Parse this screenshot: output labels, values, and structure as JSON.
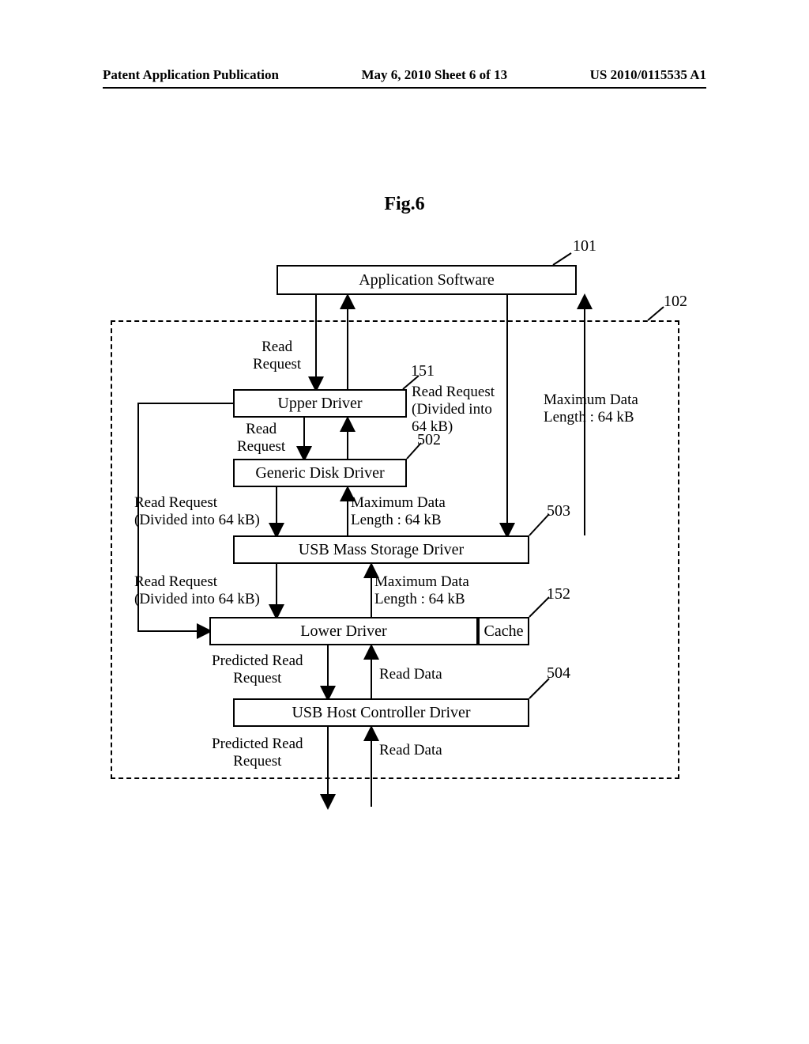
{
  "header": {
    "left": "Patent Application Publication",
    "center": "May 6, 2010  Sheet 6 of 13",
    "right": "US 2010/0115535 A1"
  },
  "figure_title": "Fig.6",
  "refs": {
    "r101": "101",
    "r102": "102",
    "r151": "151",
    "r152": "152",
    "r502": "502",
    "r503": "503",
    "r504": "504"
  },
  "boxes": {
    "app": "Application Software",
    "upper": "Upper Driver",
    "gdisk": "Generic Disk Driver",
    "usbms": "USB Mass Storage Driver",
    "lower": "Lower Driver",
    "cache": "Cache",
    "usbhc": "USB Host Controller Driver"
  },
  "labels": {
    "read_req_1": "Read\nRequest",
    "read_req_2": "Read\nRequest",
    "read_req_div_1": "Read Request\n(Divided into\n64 kB)",
    "read_req_div_2": "Read Request\n(Divided into 64 kB)",
    "read_req_div_3": "Read Request\n(Divided into 64 kB)",
    "max_len_1": "Maximum Data\nLength : 64 kB",
    "max_len_2": "Maximum Data\nLength : 64 kB",
    "max_len_3": "Maximum Data\nLength : 64 kB",
    "pred_1": "Predicted Read\nRequest",
    "pred_2": "Predicted Read\nRequest",
    "read_data_1": "Read Data",
    "read_data_2": "Read Data"
  }
}
